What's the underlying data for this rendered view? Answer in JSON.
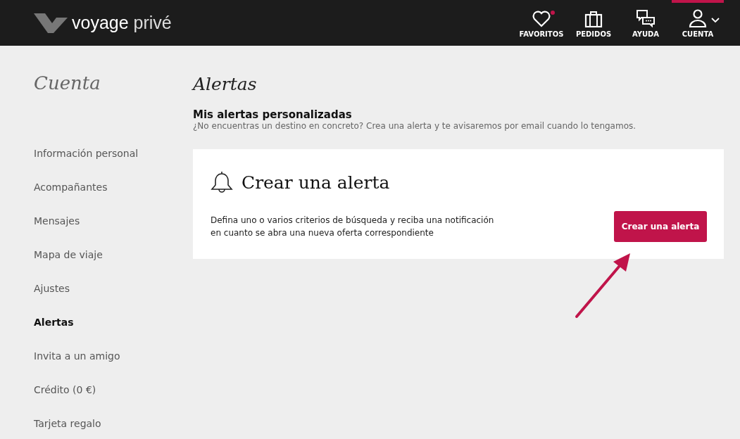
{
  "header": {
    "logo": {
      "bold": "voyage",
      "light": "privé"
    },
    "nav": [
      {
        "kind": "heart",
        "label": "FAVORITOS",
        "selected": false,
        "notification": true,
        "dropdown": false
      },
      {
        "kind": "suitcase",
        "label": "PEDIDOS",
        "selected": false,
        "notification": false,
        "dropdown": false
      },
      {
        "kind": "chat",
        "label": "AYUDA",
        "selected": false,
        "notification": false,
        "dropdown": false
      },
      {
        "kind": "user",
        "label": "CUENTA",
        "selected": true,
        "notification": false,
        "dropdown": true
      }
    ]
  },
  "sidebar": {
    "title": "Cuenta",
    "items": [
      {
        "label": "Información personal",
        "selected": false
      },
      {
        "label": "Acompañantes",
        "selected": false
      },
      {
        "label": "Mensajes",
        "selected": false
      },
      {
        "label": "Mapa de viaje",
        "selected": false
      },
      {
        "label": "Ajustes",
        "selected": false
      },
      {
        "label": "Alertas",
        "selected": true
      },
      {
        "label": "Invita a un amigo",
        "selected": false
      },
      {
        "label": "Crédito (0 €)",
        "selected": false
      },
      {
        "label": "Tarjeta regalo",
        "selected": false
      }
    ]
  },
  "main": {
    "title": "Alertas",
    "section_title": "Mis alertas personalizadas",
    "section_subtitle": "¿No encuentras un destino en concreto? Crea una alerta y te avisaremos por email cuando lo tengamos.",
    "card": {
      "title": "Crear una alerta",
      "description": "Defina uno o varios criterios de búsqueda y reciba una notificación en cuanto se abra una nueva oferta correspondiente",
      "button": "Crear una alerta"
    }
  }
}
